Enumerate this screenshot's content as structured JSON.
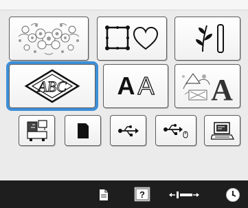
{
  "categories": [
    {
      "name": "embroidery-patterns",
      "icon": "floral-pattern-icon"
    },
    {
      "name": "frame-patterns",
      "icon": "frame-and-heart-icon"
    },
    {
      "name": "utility-designs",
      "icon": "border-pattern-icon"
    },
    {
      "name": "monogram-patterns",
      "icon": "monogram-abc-icon",
      "label": "ABC",
      "selected": true
    },
    {
      "name": "alphabet-characters",
      "icon": "alphabet-font-icon",
      "label_solid": "A",
      "label_outline": "A"
    },
    {
      "name": "decorative-alphabet",
      "icon": "decorative-alphabet-icon",
      "label": "A"
    }
  ],
  "sources": [
    {
      "name": "machine-memory",
      "icon": "machine-memory-icon"
    },
    {
      "name": "memory-card",
      "icon": "memory-card-icon"
    },
    {
      "name": "usb-port",
      "icon": "usb-icon"
    },
    {
      "name": "usb-mouse-port",
      "icon": "usb-mouse-icon"
    },
    {
      "name": "computer",
      "icon": "computer-icon"
    }
  ],
  "statusbar": {
    "icons": [
      "document-icon",
      "help-icon",
      "presser-foot-icon",
      "clock-icon"
    ],
    "help_label": "?"
  },
  "colors": {
    "selection": "#3e8fd8",
    "status_bar": "#1e1e1e",
    "panel": "#ebebeb"
  }
}
